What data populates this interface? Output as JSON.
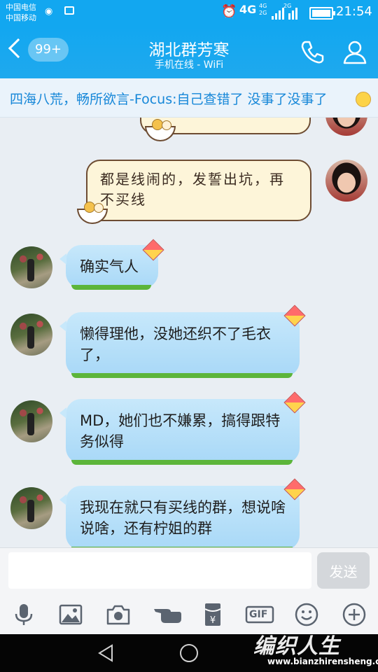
{
  "status_bar": {
    "carrier_1": "中国电信",
    "carrier_2": "中国移动",
    "network": "4G",
    "network_sub_1": "4G",
    "network_sub_2": "2G",
    "network_sub_3": "2G",
    "time": "21:54"
  },
  "header": {
    "unread_badge": "99+",
    "title": "湖北群芳寒",
    "subtitle": "手机在线 - WiFi"
  },
  "notice": {
    "text": "四海八荒，畅所欲言-Focus:自己查错了 没事了没事了"
  },
  "messages": [
    {
      "side": "right",
      "style": "yellow",
      "text": "都是线闹的，发誓出坑，再不买线"
    },
    {
      "side": "left",
      "style": "blue",
      "text": "确实气人"
    },
    {
      "side": "left",
      "style": "blue",
      "text": "懒得理他，没她还织不了毛衣了，"
    },
    {
      "side": "left",
      "style": "blue",
      "text": "MD，她们也不嫌累，搞得跟特务似得"
    },
    {
      "side": "left",
      "style": "blue",
      "text": "我现在就只有买线的群，想说啥说啥，还有柠姐的群"
    }
  ],
  "input": {
    "placeholder": "",
    "send_label": "发送"
  },
  "toolbar": {
    "icons": [
      "microphone-icon",
      "image-icon",
      "camera-icon",
      "hand-icon",
      "red-packet-icon",
      "gif-icon",
      "emoji-icon",
      "plus-icon"
    ],
    "gif_label": "GIF"
  },
  "watermark": {
    "text": "编织人生",
    "url": "www.bianzhirensheng.com"
  },
  "colors": {
    "header_blue": "#12a7f0",
    "notice_blue": "#1687d8",
    "bubble_blue": "#b5def9",
    "bubble_yellow": "#fdf5d9"
  }
}
